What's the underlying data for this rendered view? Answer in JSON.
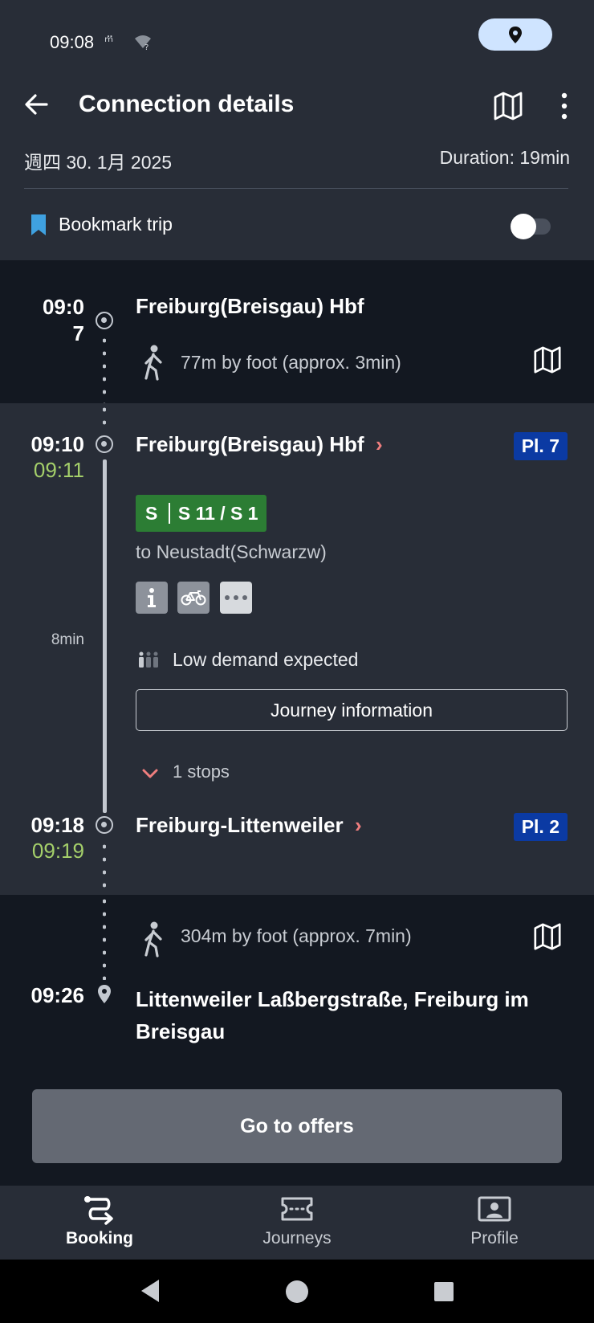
{
  "status_bar": {
    "time": "09:08",
    "icons": "m̈ ▾?"
  },
  "header": {
    "title": "Connection details"
  },
  "trip_info": {
    "date": "週四 30. 1月 2025",
    "duration": "Duration: 19min"
  },
  "bookmark": {
    "label": "Bookmark trip",
    "enabled": false
  },
  "segments": {
    "walk1": {
      "time_line1": "09:0",
      "time_line2": "7",
      "station": "Freiburg(Breisgau) Hbf",
      "walk_text": "77m by foot (approx. 3min)"
    },
    "train": {
      "departure_time": "09:10",
      "departure_realtime": "09:11",
      "departure_station": "Freiburg(Breisgau) Hbf",
      "departure_platform": "Pl. 7",
      "product_letter": "S",
      "line_name": "S 11 / S 1",
      "direction": "to Neustadt(Schwarzw)",
      "duration": "8min",
      "demand": "Low demand expected",
      "journey_info_label": "Journey information",
      "stops_label": "1 stops",
      "arrival_time": "09:18",
      "arrival_realtime": "09:19",
      "arrival_station": "Freiburg-Littenweiler",
      "arrival_platform": "Pl. 2"
    },
    "walk2": {
      "walk_text": "304m by foot (approx. 7min)",
      "arrival_time": "09:26",
      "destination_line1": "Littenweiler Laßbergstraße, Freiburg im",
      "destination_line2": "Breisgau"
    }
  },
  "cta": {
    "label": "Go to offers"
  },
  "bottom_nav": {
    "items": [
      {
        "label": "Booking",
        "active": true
      },
      {
        "label": "Journeys",
        "active": false
      },
      {
        "label": "Profile",
        "active": false
      }
    ]
  },
  "colors": {
    "background": "#282d37",
    "dark_section": "#131821",
    "realtime": "#a4cf6a",
    "sbahn_green": "#2c7d34",
    "platform_blue": "#0b3aa3",
    "accent_red": "#ef7e7e"
  }
}
